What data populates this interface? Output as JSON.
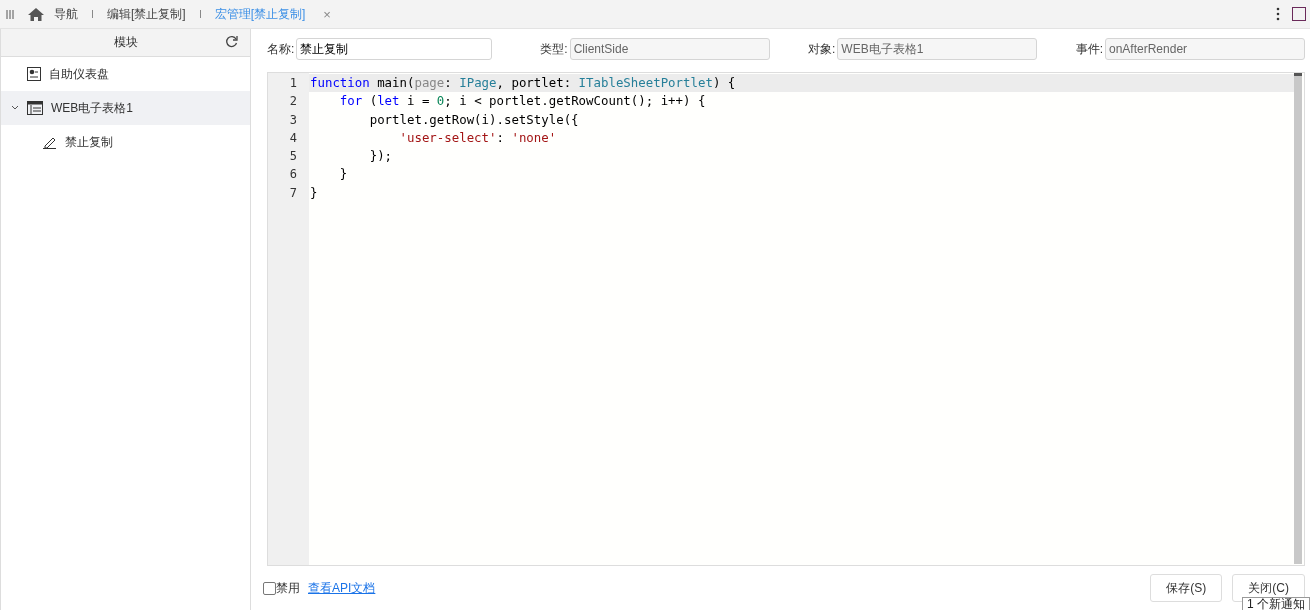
{
  "tabs": [
    {
      "label": "导航",
      "kind": "home",
      "selected": false
    },
    {
      "label": "编辑[禁止复制]",
      "kind": "plain",
      "selected": false
    },
    {
      "label": "宏管理[禁止复制]",
      "kind": "closable",
      "selected": true,
      "close": "×"
    }
  ],
  "sidebar": {
    "title": "模块",
    "items": [
      {
        "label": "自助仪表盘",
        "kind": "dashboard",
        "selected": false
      },
      {
        "label": "WEB电子表格1",
        "kind": "sheet",
        "selected": true,
        "expanded": true,
        "children": [
          {
            "label": "禁止复制",
            "kind": "macro",
            "selected": false
          }
        ]
      }
    ]
  },
  "form": [
    {
      "label": "名称:",
      "value": "禁止复制",
      "disabled": false
    },
    {
      "label": "类型:",
      "value": "ClientSide",
      "disabled": true
    },
    {
      "label": "对象:",
      "value": "WEB电子表格1",
      "disabled": true
    },
    {
      "label": "事件:",
      "value": "onAfterRender",
      "disabled": true
    }
  ],
  "editor": {
    "lines": [
      {
        "number": "1",
        "selected": true,
        "tokens": [
          {
            "kind": "keyword",
            "text": "function"
          },
          {
            "kind": "plain",
            "text": " main("
          },
          {
            "kind": "param",
            "text": "page"
          },
          {
            "kind": "plain",
            "text": ": "
          },
          {
            "kind": "type",
            "text": "IPage"
          },
          {
            "kind": "plain",
            "text": ", portlet: "
          },
          {
            "kind": "type",
            "text": "ITableSheetPortlet"
          },
          {
            "kind": "plain",
            "text": ") {"
          }
        ]
      },
      {
        "number": "2",
        "selected": false,
        "tokens": [
          {
            "kind": "keyword",
            "text": "    for"
          },
          {
            "kind": "plain",
            "text": " ("
          },
          {
            "kind": "keyword",
            "text": "let"
          },
          {
            "kind": "plain",
            "text": " i = "
          },
          {
            "kind": "number",
            "text": "0"
          },
          {
            "kind": "plain",
            "text": "; i < portlet.getRowCount(); i++) {"
          }
        ]
      },
      {
        "number": "3",
        "selected": false,
        "tokens": [
          {
            "kind": "plain",
            "text": "        portlet.getRow(i).setStyle({"
          }
        ]
      },
      {
        "number": "4",
        "selected": false,
        "tokens": [
          {
            "kind": "string",
            "text": "            'user-select'"
          },
          {
            "kind": "plain",
            "text": ": "
          },
          {
            "kind": "string",
            "text": "'none'"
          }
        ]
      },
      {
        "number": "5",
        "selected": false,
        "tokens": [
          {
            "kind": "plain",
            "text": "        });"
          }
        ]
      },
      {
        "number": "6",
        "selected": false,
        "tokens": [
          {
            "kind": "plain",
            "text": "    }"
          }
        ]
      },
      {
        "number": "7",
        "selected": false,
        "tokens": [
          {
            "kind": "plain",
            "text": "}"
          }
        ]
      }
    ]
  },
  "footer": {
    "disable": {
      "label": "禁用",
      "checked": false
    },
    "link": "查看API文档",
    "buttons": [
      "保存(S)",
      "关闭(C)"
    ]
  },
  "toast": "1 个新通知"
}
